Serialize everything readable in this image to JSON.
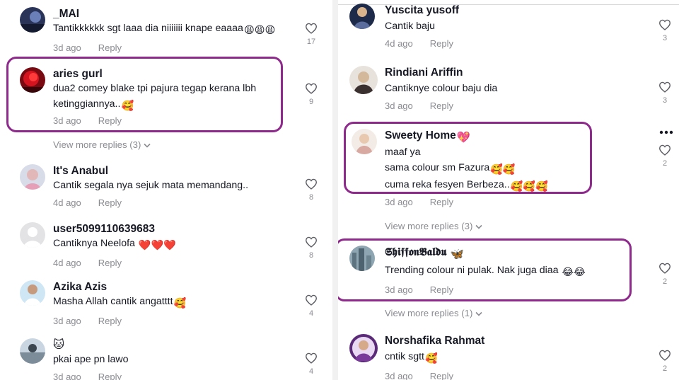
{
  "left": {
    "comments": [
      {
        "username": "_MAI",
        "text": "Tantikkkkkk sgt laaa dia niiiiiii knape eaaaa",
        "emoji": "😩😩😩",
        "date": "3d ago",
        "reply": "Reply",
        "likes": "17"
      },
      {
        "username": "aries gurl",
        "text_line1": "dua2 comey blake tpi pajura tegap kerana lbh",
        "text_line2": "ketinggiannya..",
        "emoji": "🥰",
        "date": "3d ago",
        "reply": "Reply",
        "likes": "9"
      },
      {
        "username": "It's Anabul",
        "text": "Cantik segala nya sejuk mata memandang..",
        "date": "4d ago",
        "reply": "Reply",
        "likes": "8"
      },
      {
        "username": "user5099110639683",
        "text": "Cantiknya Neelofa",
        "emoji": "❤️❤️❤️",
        "date": "4d ago",
        "reply": "Reply",
        "likes": "8"
      },
      {
        "username": "Azika Azis",
        "text": "Masha Allah cantik angatttt",
        "emoji": "🥰",
        "date": "3d ago",
        "reply": "Reply",
        "likes": "4"
      },
      {
        "username": "🐱",
        "text": "pkai ape pn lawo",
        "date": "3d ago",
        "reply": "Reply",
        "likes": "4"
      }
    ],
    "view_more": "View more replies (3)"
  },
  "right": {
    "comments": [
      {
        "username": "Yuscita yusoff",
        "text": "Cantik baju",
        "date": "4d ago",
        "reply": "Reply",
        "likes": "3"
      },
      {
        "username": "Rindiani Ariffin",
        "text": "Cantiknye colour baju dia",
        "date": "3d ago",
        "reply": "Reply",
        "likes": "3"
      },
      {
        "username": "Sweety Home",
        "username_emoji": "💖",
        "text_line1": "maaf ya",
        "text_line2": "sama colour sm Fazura",
        "text_line2_emoji": "🥰🥰",
        "text_line3": "cuma reka fesyen Berbeza..",
        "text_line3_emoji": "🥰🥰🥰",
        "date": "3d ago",
        "reply": "Reply",
        "likes": "2"
      },
      {
        "username": "𝕾𝖍𝖎𝖋𝖋𝖔𝖓𝕭𝖆𝖑𝖉𝖚",
        "username_emoji": "🦋",
        "text": "Trending colour ni pulak. Nak juga diaa",
        "emoji": "😂😂",
        "date": "3d ago",
        "reply": "Reply",
        "likes": "2"
      },
      {
        "username": "Norshafika Rahmat",
        "text": "cntik sgtt",
        "emoji": "🥰",
        "date": "3d ago",
        "reply": "Reply",
        "likes": "2"
      }
    ],
    "view_more_1": "View more replies (3)",
    "view_more_2": "View more replies (1)"
  },
  "colors": {
    "highlight": "#8e2a8c",
    "muted": "#8a8b91",
    "text": "#161823"
  }
}
